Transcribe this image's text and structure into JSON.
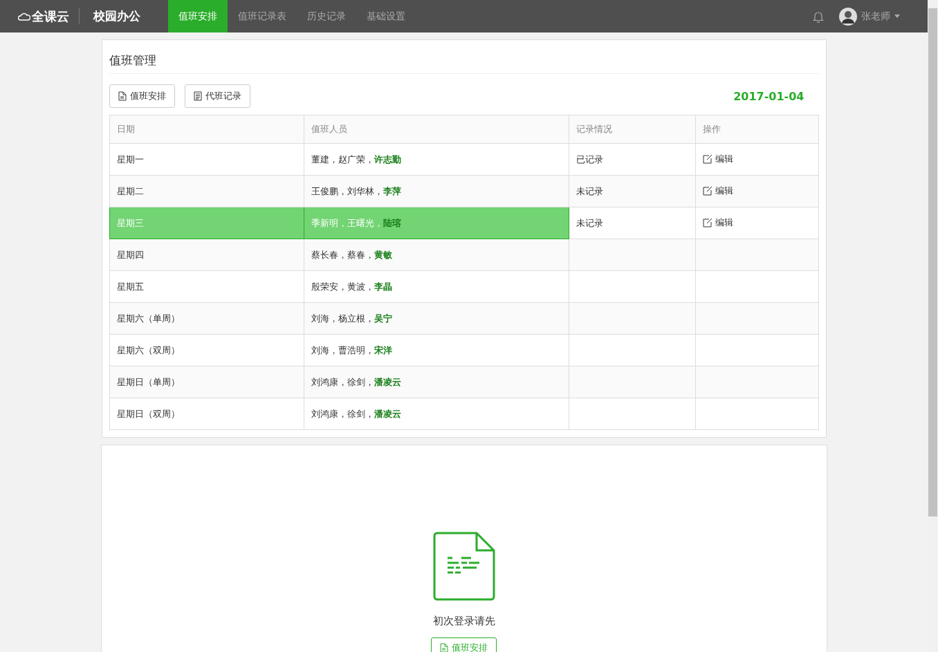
{
  "navbar": {
    "logo": "全课云",
    "app_title": "校园办公",
    "tabs": [
      {
        "label": "值班安排",
        "selected": true
      },
      {
        "label": "值班记录表",
        "selected": false
      },
      {
        "label": "历史记录",
        "selected": false
      },
      {
        "label": "基础设置",
        "selected": false
      }
    ],
    "user": {
      "name": "张老师"
    }
  },
  "panel": {
    "title": "值班管理",
    "buttons": [
      {
        "label": "值班安排",
        "kind": "doc"
      },
      {
        "label": "代班记录",
        "kind": "list"
      }
    ],
    "date": "2017-01-04",
    "table": {
      "columns": [
        "日期",
        "值班人员",
        "记录情况",
        "操作"
      ],
      "rows": [
        {
          "day": "星期一",
          "staff": "董建，赵广荣，**许志勤**",
          "record": "已记录",
          "action": "编辑",
          "selected": false
        },
        {
          "day": "星期二",
          "staff": "王俊鹏，刘华林，**李萍**",
          "record": "未记录",
          "action": "编辑",
          "selected": false
        },
        {
          "day": "星期三",
          "staff": "季新明，王曙光，**陆瑢**",
          "record": "未记录",
          "action": "编辑",
          "selected": true
        },
        {
          "day": "星期四",
          "staff": "蔡长春，蔡春，**黄敏**",
          "selected": false
        },
        {
          "day": "星期五",
          "staff": "殷荣安，黄波，**李晶**",
          "selected": false
        },
        {
          "day": "星期六（单周）",
          "staff": "刘海，杨立根，**吴宁**",
          "selected": false
        },
        {
          "day": "星期六（双周）",
          "staff": "刘海，曹浩明，**宋洋**",
          "selected": false
        },
        {
          "day": "星期日（单周）",
          "staff": "刘鸿康，徐剑，**潘凌云**",
          "selected": false
        },
        {
          "day": "星期日（双周）",
          "staff": "刘鸿康，徐剑，**潘凌云**",
          "selected": false
        }
      ]
    }
  },
  "empty_state": {
    "message": "初次登录请先",
    "button": "值班安排"
  }
}
